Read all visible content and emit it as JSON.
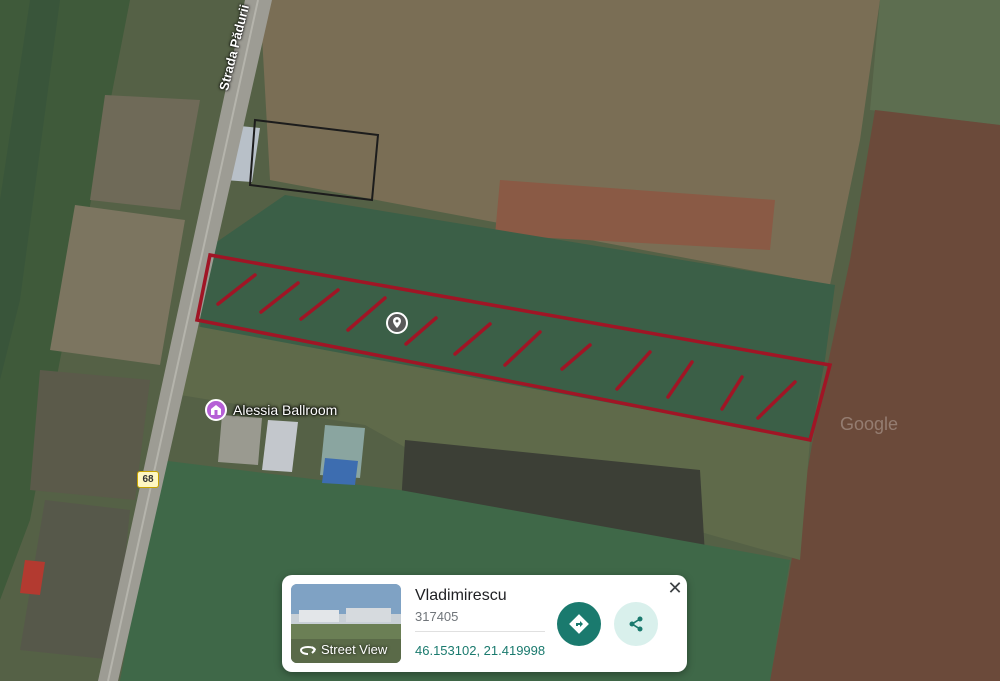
{
  "map": {
    "street_name": "Strada Pădurii",
    "route_number": "68",
    "poi": {
      "name": "Alessia Ballroom",
      "icon": "venue-pin-icon",
      "color": "#b65fd6"
    },
    "highlight_color": "#a01525",
    "watermark": "Google"
  },
  "card": {
    "place_name": "Vladimirescu",
    "postal_code": "317405",
    "coordinates": "46.153102, 21.419998",
    "street_view_label": "Street View",
    "accent": "#1a7a6e",
    "close_symbol": "✕"
  }
}
